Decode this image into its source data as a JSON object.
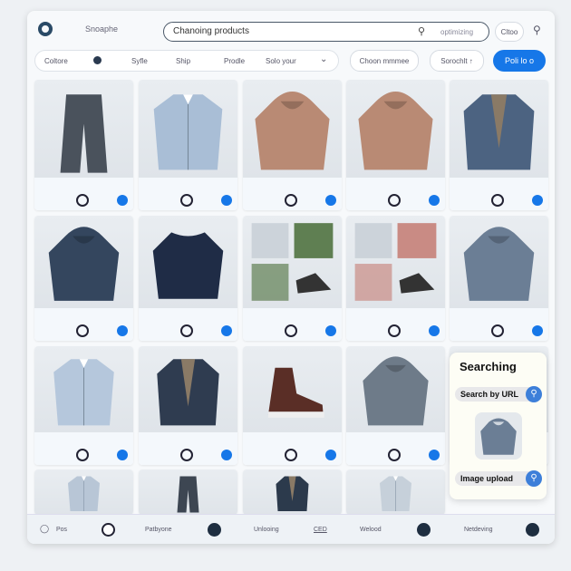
{
  "header": {
    "brand": "Snoaphe",
    "search_value": "Chanoing products",
    "search_option": "optimizing",
    "filter_button": "Cltoo"
  },
  "filters": {
    "items": [
      "Coltore",
      "Syfle",
      "Ship",
      "Prodle",
      "Solo your"
    ],
    "choose": "Choon mmmee",
    "sort": "Sorochlt ↑",
    "primary": "Poli lo o"
  },
  "cards": [
    {
      "kind": "pants",
      "color": "#4a525c"
    },
    {
      "kind": "shirt",
      "color": "#a9bed6"
    },
    {
      "kind": "hoodie",
      "color": "#b98a74"
    },
    {
      "kind": "hoodie",
      "color": "#b98a74"
    },
    {
      "kind": "jacket",
      "color": "#4c6381"
    },
    {
      "kind": "hoodie",
      "color": "#34465e"
    },
    {
      "kind": "sweater",
      "color": "#1f2c46"
    },
    {
      "kind": "collage",
      "color": "#5f7f52"
    },
    {
      "kind": "collage",
      "color": "#c98b84"
    },
    {
      "kind": "hoodie",
      "color": "#6b7e95"
    },
    {
      "kind": "shirt",
      "color": "#b5c7dc"
    },
    {
      "kind": "jacket",
      "color": "#2f3c50"
    },
    {
      "kind": "shoe",
      "color": "#5a2e26"
    },
    {
      "kind": "hoodie",
      "color": "#6e7b89"
    },
    {
      "kind": "hoodie",
      "color": "#a87462"
    },
    {
      "kind": "shirt",
      "color": "#b8c6d6"
    },
    {
      "kind": "pants",
      "color": "#3d4652"
    },
    {
      "kind": "jacket",
      "color": "#2c3a4c"
    },
    {
      "kind": "shirt",
      "color": "#c6d0da"
    }
  ],
  "panel": {
    "title": "Searching",
    "url_label": "Search by URL",
    "upload_label": "Image upload",
    "preview_color": "#6b7e95"
  },
  "bottom": {
    "items": [
      "Pos",
      "Patbyone",
      "Unlooing",
      "CED",
      "Welood",
      "Netdeving"
    ]
  },
  "colors": {
    "accent": "#1677e8",
    "dark": "#1e2e40"
  }
}
